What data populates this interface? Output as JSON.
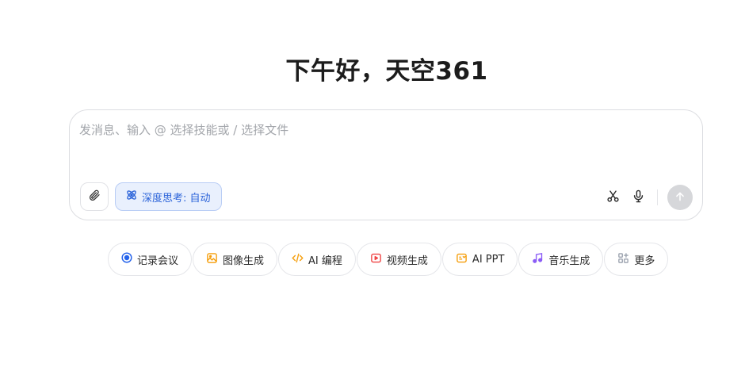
{
  "greeting": "下午好，天空361",
  "composer": {
    "placeholder": "发消息、输入 @ 选择技能或 / 选择文件",
    "value": "",
    "deep_think_label": "深度思考: 自动"
  },
  "quick_actions": [
    {
      "label": "记录会议",
      "icon": "record-icon",
      "color": "#2563eb"
    },
    {
      "label": "图像生成",
      "icon": "image-icon",
      "color": "#f59e0b"
    },
    {
      "label": "AI 编程",
      "icon": "code-icon",
      "color": "#f59e0b"
    },
    {
      "label": "视频生成",
      "icon": "video-icon",
      "color": "#ef4444"
    },
    {
      "label": "AI PPT",
      "icon": "ppt-icon",
      "color": "#f59e0b"
    },
    {
      "label": "音乐生成",
      "icon": "music-icon",
      "color": "#8b5cf6"
    },
    {
      "label": "更多",
      "icon": "grid-icon",
      "color": "#9ca3af"
    }
  ]
}
